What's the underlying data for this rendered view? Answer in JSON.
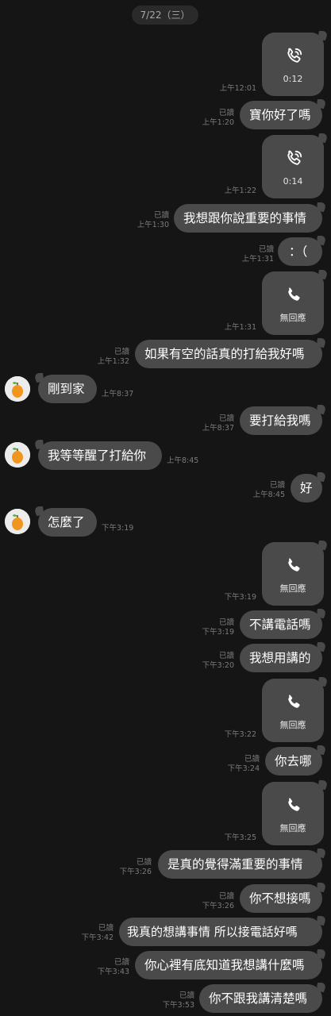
{
  "date_header": "7/22（三）",
  "read_label": "已讀",
  "messages": {
    "m1": {
      "call_label": "0:12",
      "time": "上午12:01"
    },
    "m2": {
      "text": "寶你好了嗎",
      "time": "上午1:20"
    },
    "m3": {
      "call_label": "0:14",
      "time": "上午1:22"
    },
    "m4": {
      "text": "我想跟你說重要的事情",
      "time": "上午1:30"
    },
    "m5": {
      "text": "：（",
      "time": "上午1:31"
    },
    "m6": {
      "call_label": "無回應",
      "time": "上午1:31"
    },
    "m7": {
      "text": "如果有空的話真的打給我好嗎",
      "time": "上午1:32"
    },
    "m8": {
      "text": "剛到家",
      "time": "上午8:37"
    },
    "m9": {
      "text": "要打給我嗎",
      "time": "上午8:37"
    },
    "m10": {
      "text": "我等等醒了打給你",
      "time": "上午8:45"
    },
    "m11": {
      "text": "好",
      "time": "上午8:45"
    },
    "m12": {
      "text": "怎麼了",
      "time": "下午3:19"
    },
    "m13": {
      "call_label": "無回應",
      "time": "下午3:19"
    },
    "m14": {
      "text": "不講電話嗎",
      "time": "下午3:19"
    },
    "m15": {
      "text": "我想用講的",
      "time": "下午3:20"
    },
    "m16": {
      "call_label": "無回應",
      "time": "下午3:22"
    },
    "m17": {
      "text": "你去哪",
      "time": "下午3:24"
    },
    "m18": {
      "call_label": "無回應",
      "time": "下午3:25"
    },
    "m19": {
      "text": "是真的覺得滿重要的事情",
      "time": "下午3:26"
    },
    "m20": {
      "text": "你不想接嗎",
      "time": "下午3:26"
    },
    "m21": {
      "text": "我真的想講事情 所以接電話好嗎",
      "time": "下午3:42"
    },
    "m22": {
      "text": "你心裡有底知道我想講什麼嗎",
      "time": "下午3:43"
    },
    "m23": {
      "text": "你不跟我講清楚嗎",
      "time": "下午3:53"
    }
  },
  "icons": {
    "call_connected": "phone-waves-icon",
    "call_missed": "phone-icon",
    "avatar": "orange-fruit-avatar"
  },
  "colors": {
    "background": "#151515",
    "bubble": "#4a4a4a",
    "meta_text": "#7a7a7a"
  }
}
